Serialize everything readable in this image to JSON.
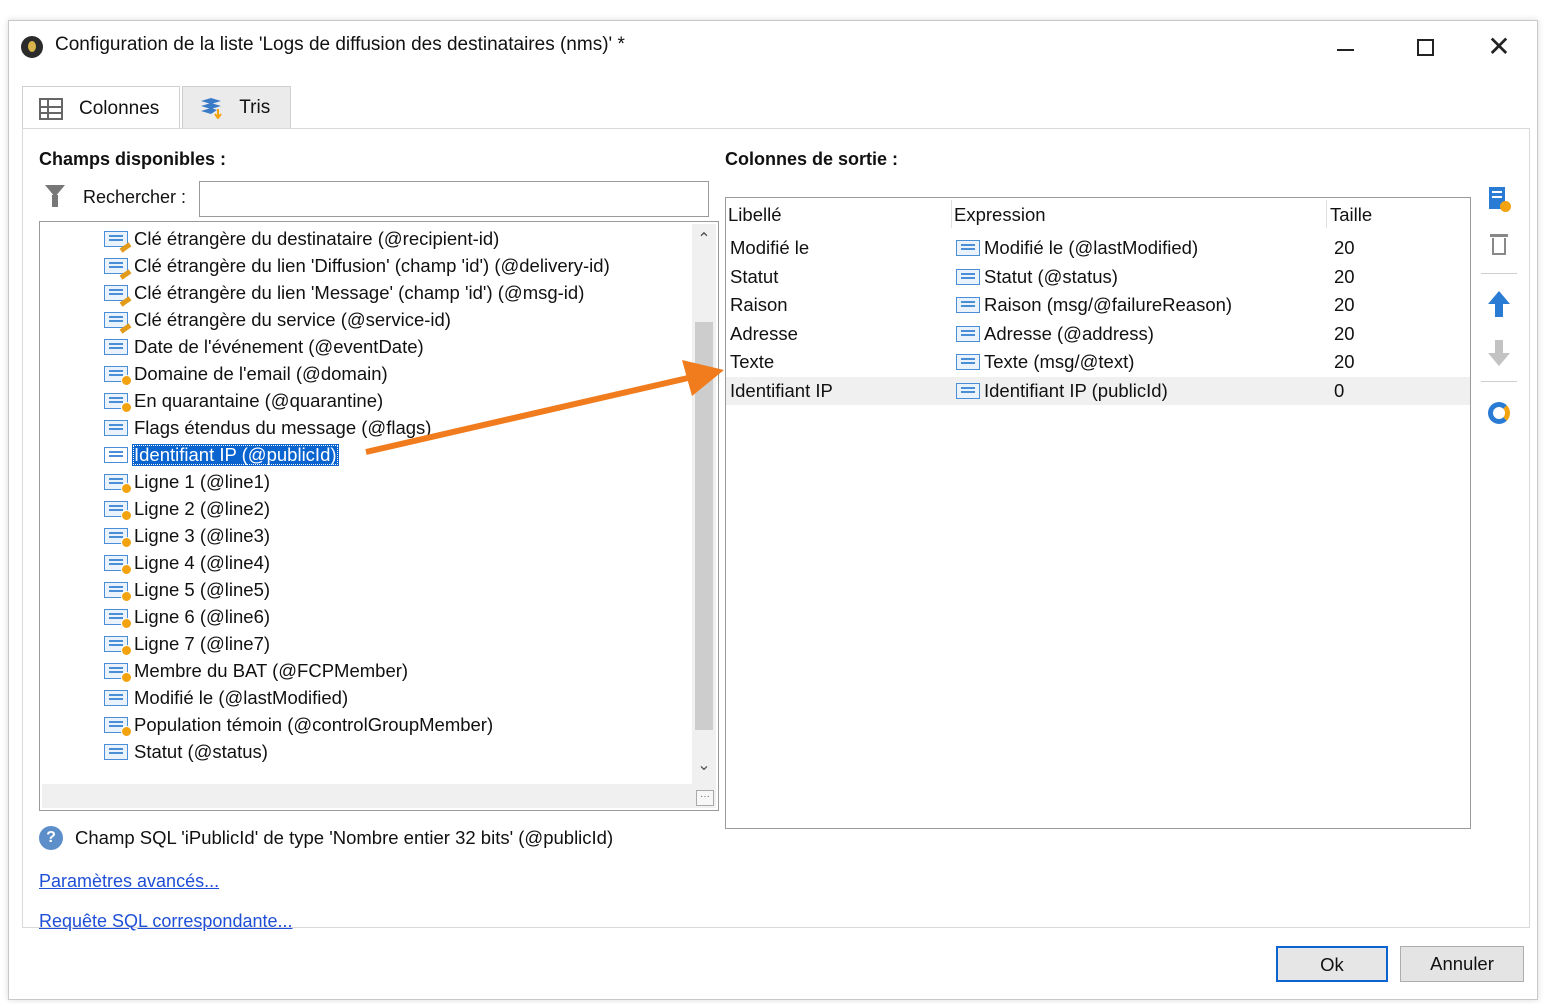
{
  "window": {
    "title": "Configuration de la liste 'Logs de diffusion des destinataires (nms)' *"
  },
  "tabs": [
    {
      "label": "Colonnes"
    },
    {
      "label": "Tris"
    }
  ],
  "available_fields": {
    "title": "Champs disponibles :",
    "search_label": "Rechercher :",
    "search_value": "",
    "items": [
      {
        "label": "Clé étrangère du destinataire (@recipient-id)",
        "icon": "foreign-key-field-icon"
      },
      {
        "label": "Clé étrangère du lien 'Diffusion' (champ 'id') (@delivery-id)",
        "icon": "foreign-key-field-icon"
      },
      {
        "label": "Clé étrangère du lien 'Message' (champ 'id') (@msg-id)",
        "icon": "foreign-key-field-icon"
      },
      {
        "label": "Clé étrangère du service (@service-id)",
        "icon": "foreign-key-field-icon"
      },
      {
        "label": "Date de l'événement (@eventDate)",
        "icon": "field-icon"
      },
      {
        "label": "Domaine de l'email (@domain)",
        "icon": "enum-field-icon"
      },
      {
        "label": "En quarantaine (@quarantine)",
        "icon": "enum-field-icon"
      },
      {
        "label": "Flags étendus du message (@flags)",
        "icon": "field-icon"
      },
      {
        "label": "Identifiant IP (@publicId)",
        "icon": "field-icon",
        "selected": true
      },
      {
        "label": "Ligne 1 (@line1)",
        "icon": "enum-field-icon"
      },
      {
        "label": "Ligne 2 (@line2)",
        "icon": "enum-field-icon"
      },
      {
        "label": "Ligne 3 (@line3)",
        "icon": "enum-field-icon"
      },
      {
        "label": "Ligne 4 (@line4)",
        "icon": "enum-field-icon"
      },
      {
        "label": "Ligne 5 (@line5)",
        "icon": "enum-field-icon"
      },
      {
        "label": "Ligne 6 (@line6)",
        "icon": "enum-field-icon"
      },
      {
        "label": "Ligne 7 (@line7)",
        "icon": "enum-field-icon"
      },
      {
        "label": "Membre du BAT (@FCPMember)",
        "icon": "enum-field-icon"
      },
      {
        "label": "Modifié le (@lastModified)",
        "icon": "field-icon"
      },
      {
        "label": "Population témoin (@controlGroupMember)",
        "icon": "enum-field-icon"
      },
      {
        "label": "Statut (@status)",
        "icon": "field-icon"
      }
    ],
    "info_text": "Champ SQL 'iPublicId' de type 'Nombre entier 32 bits' (@publicId)",
    "advanced_link": "Paramètres avancés...",
    "sql_link": "Requête SQL correspondante..."
  },
  "output_columns": {
    "title": "Colonnes de sortie :",
    "headers": {
      "label": "Libellé",
      "expression": "Expression",
      "size": "Taille"
    },
    "rows": [
      {
        "label": "Modifié le",
        "expression": "Modifié le (@lastModified)",
        "size": "20"
      },
      {
        "label": "Statut",
        "expression": "Statut (@status)",
        "size": "20"
      },
      {
        "label": "Raison",
        "expression": "Raison (msg/@failureReason)",
        "size": "20"
      },
      {
        "label": "Adresse",
        "expression": "Adresse (@address)",
        "size": "20"
      },
      {
        "label": "Texte",
        "expression": "Texte (msg/@text)",
        "size": "20"
      },
      {
        "label": "Identifiant IP",
        "expression": "Identifiant IP (publicId)",
        "size": "0",
        "highlighted": true
      }
    ]
  },
  "buttons": {
    "ok": "Ok",
    "cancel": "Annuler"
  },
  "colors": {
    "accent": "#0a64d0",
    "annotation_arrow": "#f07c1e",
    "link": "#1f4fd6"
  }
}
